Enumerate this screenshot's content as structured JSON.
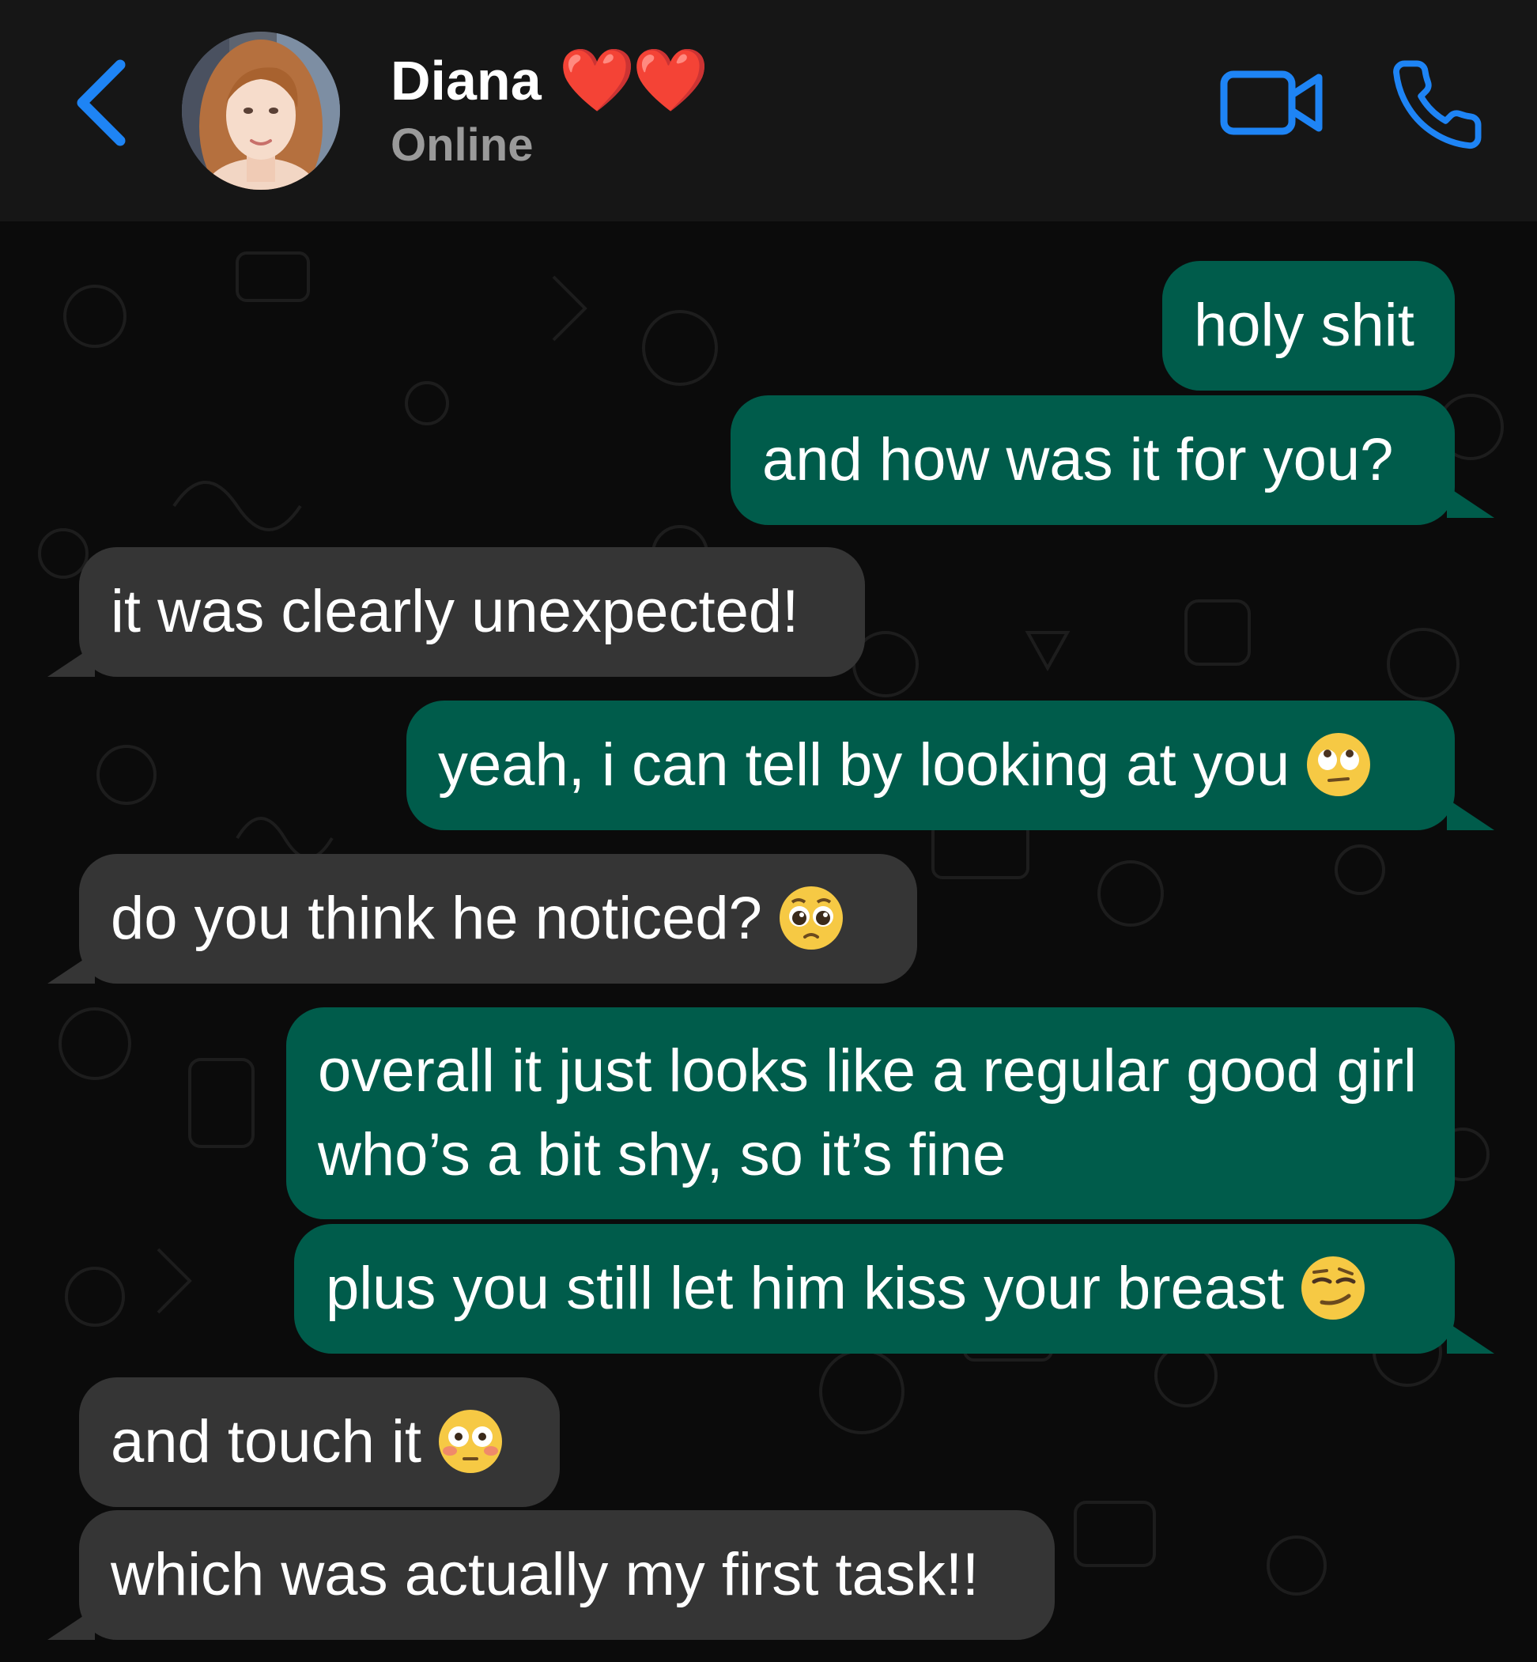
{
  "header": {
    "contact_name": "Diana",
    "contact_name_emoji": "❤️❤️",
    "status": "Online",
    "back_icon": "chevron-left-icon",
    "video_icon": "video-camera-icon",
    "call_icon": "phone-icon"
  },
  "colors": {
    "accent": "#1e84f5",
    "outgoing_bubble": "#005c4b",
    "incoming_bubble": "#353535",
    "header_bg": "#161616",
    "chat_bg": "#0b0b0b"
  },
  "messages": [
    {
      "direction": "outgoing",
      "text": "holy shit"
    },
    {
      "direction": "outgoing",
      "text": "and how was it for you?"
    },
    {
      "direction": "incoming",
      "text": "it was clearly unexpected!"
    },
    {
      "direction": "outgoing",
      "text": "yeah, i can tell by looking at you",
      "emoji": "face-with-rolling-eyes"
    },
    {
      "direction": "incoming",
      "text": "do you think he noticed?",
      "emoji": "pleading-face"
    },
    {
      "direction": "outgoing",
      "text": "overall it just looks like a regular good girl who’s a bit shy, so it’s fine"
    },
    {
      "direction": "outgoing",
      "text": "plus you still let him kiss your breast",
      "emoji": "smirking-face"
    },
    {
      "direction": "incoming",
      "text": "and touch it",
      "emoji": "flushed-face"
    },
    {
      "direction": "incoming",
      "text": "which was actually my first task!!"
    }
  ]
}
